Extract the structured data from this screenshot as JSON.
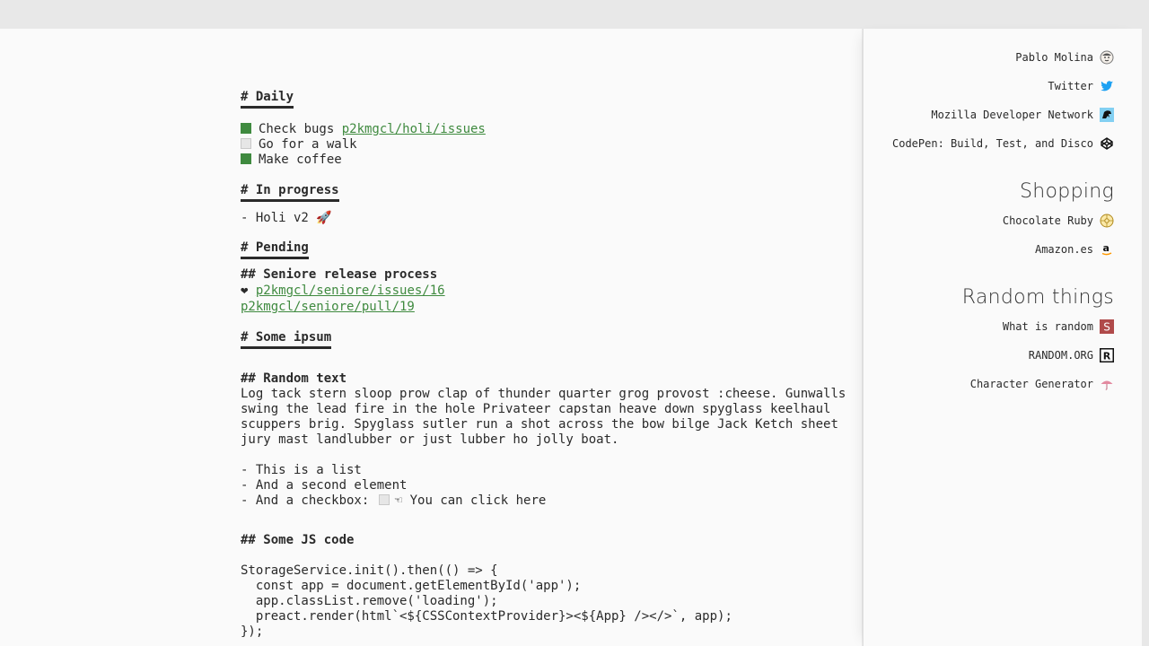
{
  "editor": {
    "daily_heading": "# Daily",
    "daily_items": [
      {
        "text": "Check bugs ",
        "link": "p2kmgcl/holi/issues",
        "checked": true
      },
      {
        "text": "Go for a walk",
        "checked": false
      },
      {
        "text": "Make coffee",
        "checked": true
      }
    ],
    "in_progress_heading": "# In progress",
    "in_progress_item": "- Holi v2 🚀",
    "pending_heading": "# Pending",
    "seniore_heading": "## Seniore release process",
    "seniore_heart": "❤",
    "seniore_link_1": "p2kmgcl/seniore/issues/16",
    "seniore_link_2": "p2kmgcl/seniore/pull/19",
    "ipsum_heading": "# Some ipsum",
    "random_text_heading": "## Random text",
    "random_text_lines": [
      "Log tack stern sloop prow clap of thunder quarter grog provost :cheese. Gunwalls",
      "swing the lead fire in the hole Privateer capstan heave down spyglass keelhaul",
      "scuppers brig. Spyglass sutler run a shot across the bow bilge Jack Ketch sheet",
      "jury mast landlubber or just lubber ho jolly boat."
    ],
    "list_item_1": "- This is a list",
    "list_item_2": "- And a second element",
    "list_item_3_prefix": "- And a checkbox:",
    "list_item_3_checked": false,
    "list_item_3_hand": "☜",
    "list_item_3_suffix": "You can click here",
    "js_heading": "## Some JS code",
    "js_code_lines": [
      "StorageService.init().then(() => {",
      "  const app = document.getElementById('app');",
      "  app.classList.remove('loading');",
      "  preact.render(html`<${CSSContextProvider}><${App} /></>`, app);",
      "});"
    ]
  },
  "sidebar": {
    "links": [
      {
        "label": "Pablo Molina",
        "icon": "avatar-face-icon"
      },
      {
        "label": "Twitter",
        "icon": "twitter-bird-icon",
        "color": "#1da1f2"
      },
      {
        "label": "Mozilla Developer Network",
        "icon": "mdn-dino-icon",
        "color": "#83d0f2"
      },
      {
        "label": "CodePen: Build, Test, and Discov",
        "icon": "codepen-cube-icon"
      }
    ],
    "shopping_title": "Shopping",
    "shopping_links": [
      {
        "label": "Chocolate Ruby",
        "icon": "chocolate-icon",
        "color": "#c9a227"
      },
      {
        "label": "Amazon.es",
        "icon": "amazon-icon",
        "color": "#ff9900"
      }
    ],
    "random_title": "Random things",
    "random_links": [
      {
        "label": "What is random",
        "icon": "s-square-icon",
        "glyph": "S",
        "color": "#b04a4a"
      },
      {
        "label": "RANDOM.ORG",
        "icon": "r-square-icon",
        "glyph": "R"
      },
      {
        "label": "Character Generator",
        "icon": "umbrella-icon",
        "color": "#e38aa0"
      }
    ]
  }
}
